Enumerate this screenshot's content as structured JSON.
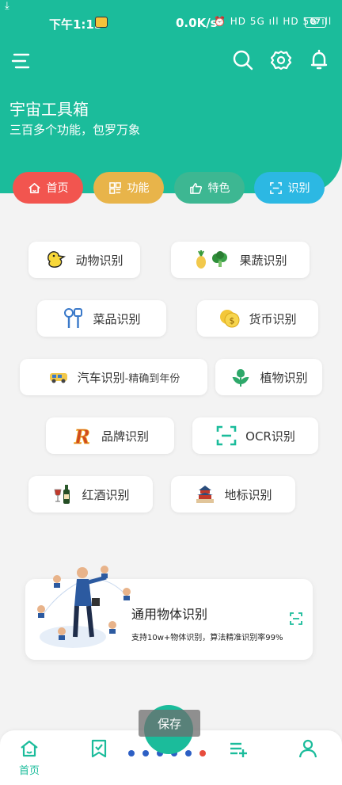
{
  "status": {
    "time": "下午1:15",
    "net_speed": "0.0K/s",
    "sys_icons": "⏰ HD 5G ıll HD 5G ıll",
    "battery": "87"
  },
  "header": {
    "title": "宇宙工具箱",
    "subtitle": "三百多个功能，包罗万象"
  },
  "tabs": [
    {
      "label": "首页",
      "color": "#f2554f",
      "icon": "home-icon"
    },
    {
      "label": "功能",
      "color": "#e8b44a",
      "icon": "grid-icon"
    },
    {
      "label": "特色",
      "color": "#3db792",
      "icon": "thumb-up-icon"
    },
    {
      "label": "识别",
      "color": "#2cb8e3",
      "icon": "scan-icon"
    }
  ],
  "features": [
    {
      "label": "动物识别",
      "icon": "duck-icon"
    },
    {
      "label": "果蔬识别",
      "icon": "fruit-veg-icon"
    },
    {
      "label": "菜品识别",
      "icon": "utensils-icon"
    },
    {
      "label": "货币识别",
      "icon": "coin-icon"
    },
    {
      "label": "汽车识别",
      "sub": "-精确到年份",
      "icon": "car-icon"
    },
    {
      "label": "植物识别",
      "icon": "plant-icon"
    },
    {
      "label": "品牌识别",
      "icon": "brand-r-icon"
    },
    {
      "label": "OCR识别",
      "icon": "ocr-scan-icon"
    },
    {
      "label": "红酒识别",
      "icon": "wine-icon"
    },
    {
      "label": "地标识别",
      "icon": "landmark-icon"
    }
  ],
  "banner": {
    "title": "通用物体识别",
    "description": "支持10w+物体识别，算法精准识别率99%"
  },
  "toast": "保存",
  "bottom_nav": {
    "home_label": "首页",
    "pager_dots": [
      "#2d5fc4",
      "#2d5fc4",
      "#2d5fc4",
      "#2d5fc4",
      "#2d5fc4",
      "#e74c3c"
    ]
  },
  "colors": {
    "accent": "#1bbc9b"
  }
}
